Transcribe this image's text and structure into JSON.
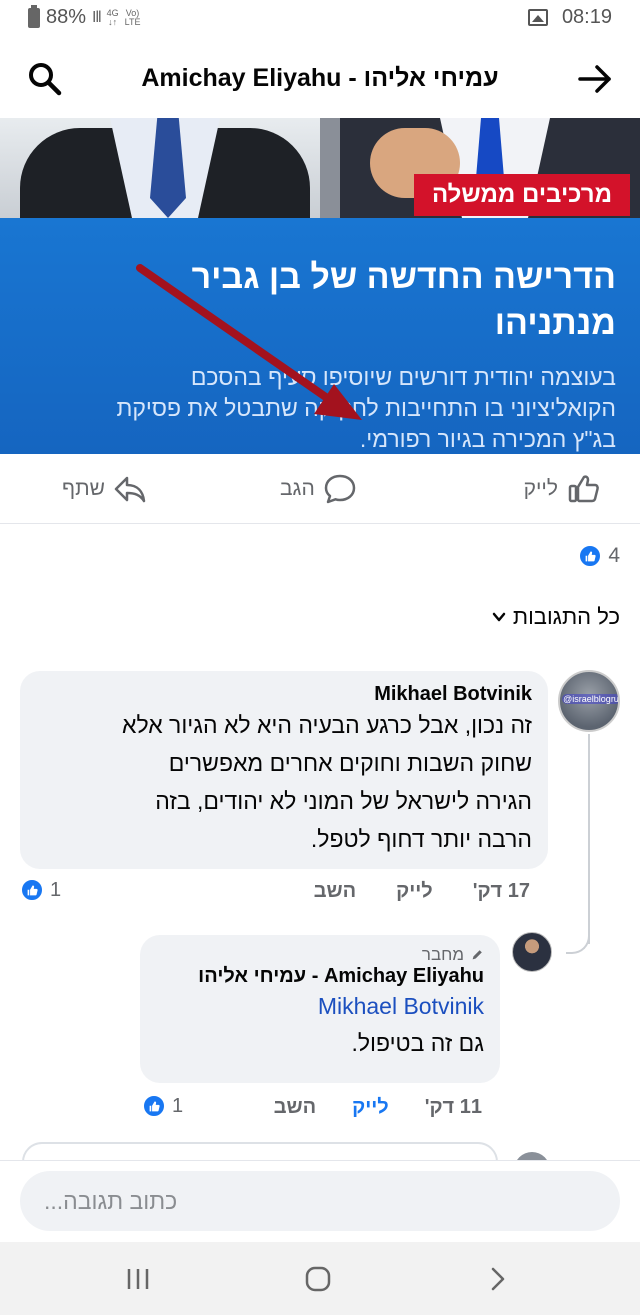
{
  "status_bar": {
    "battery": "88%",
    "network": "4G",
    "volte_line1": "Vo)",
    "volte_line2": "LTE",
    "time": "08:19"
  },
  "header": {
    "title": "Amichay Eliyahu - עמיחי אליהו",
    "search_icon": "search-icon",
    "forward_icon": "arrow-right-icon"
  },
  "post_image": {
    "tag": "מרכיבים ממשלה",
    "headline_line1": "הדרישה החדשה של בן גביר",
    "headline_line2": "מנתניהו",
    "subtext_line1": "בעוצמה יהודית דורשים שיוסיפו סעיף בהסכם",
    "subtext_line2": "הקואליציוני בו התחייבות לחקיקה שתבטל את פסיקת",
    "subtext_line3": "בג\"ץ המכירה בגיור רפורמי."
  },
  "actions": {
    "like": "לייק",
    "comment": "הגב",
    "share": "שתף"
  },
  "reactions": {
    "count": "4"
  },
  "filter": {
    "label": "כל התגובות"
  },
  "comments": [
    {
      "author": "Mikhael Botvinik",
      "avatar_label": "@israelblogru",
      "text_line1": "זה נכון, אבל כרגע הבעיה היא לא הגיור אלא",
      "text_line2": "שחוק השבות וחוקים אחרים מאפשרים",
      "text_line3": "הגירה לישראל של המוני לא יהודים, בזה",
      "text_line4": "הרבה יותר דחוף לטפל.",
      "time": "17 דק'",
      "like": "לייק",
      "reply": "השב",
      "reactions": "1"
    },
    {
      "badge": "מחבר",
      "author": "Amichay Eliyahu - עמיחי אליהו",
      "mention": "Mikhael Botvinik",
      "text": "גם זה בטיפול.",
      "time": "11 דק'",
      "like": "לייק",
      "reply": "השב",
      "reactions": "1"
    }
  ],
  "composer": {
    "placeholder": "כתוב תגובה..."
  },
  "colors": {
    "accent": "#1877f2",
    "image_blue": "#1565c0",
    "tag_red": "#d3122a",
    "bubble": "#f0f2f5"
  }
}
